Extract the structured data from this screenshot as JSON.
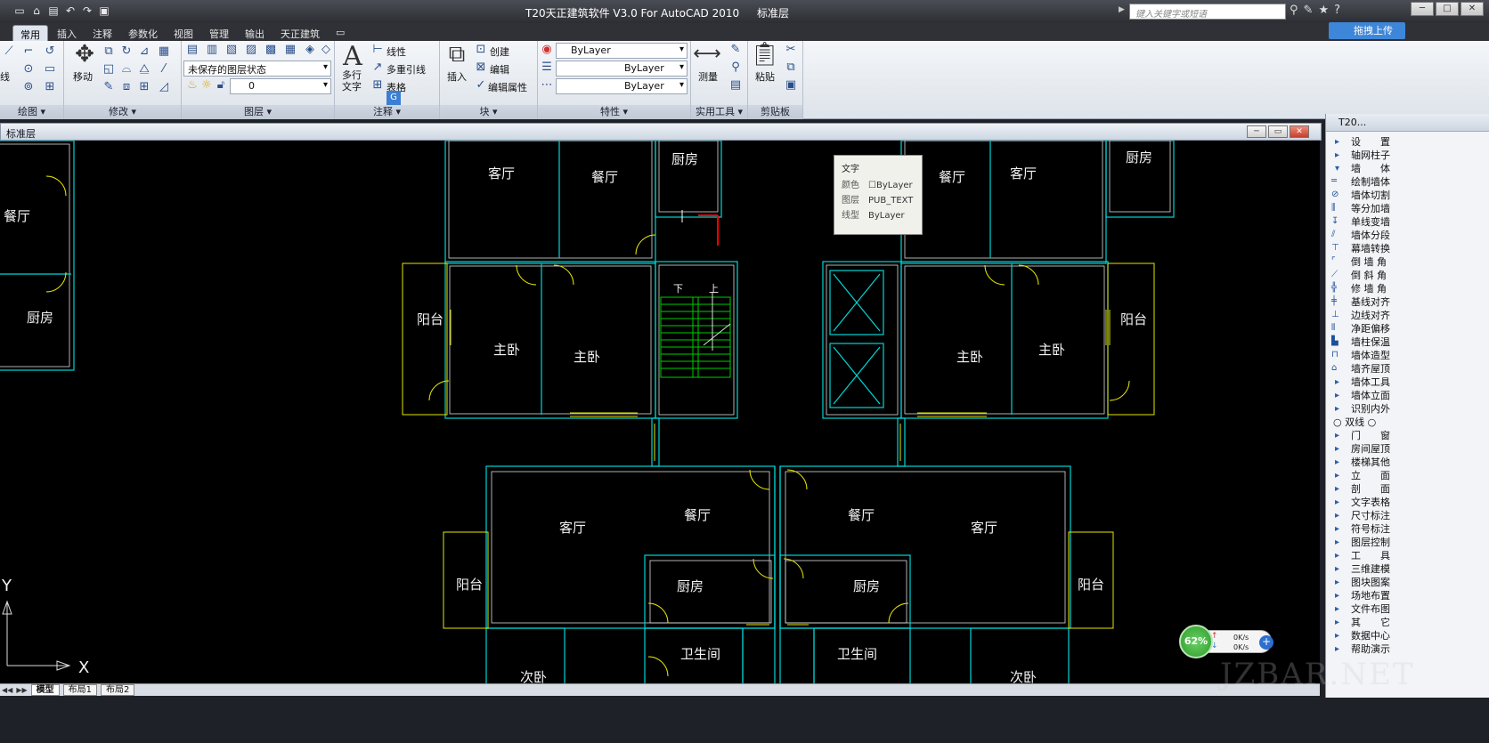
{
  "app": {
    "title": "T20天正建筑软件 V3.0 For AutoCAD 2010",
    "layer_title": "标准层",
    "search_placeholder": "键入关键字或短语",
    "upload_label": "拖拽上传"
  },
  "quick_access": [
    "new-icon",
    "open-icon",
    "save-icon",
    "undo-icon",
    "redo-icon",
    "print-icon"
  ],
  "ribbon_tabs": [
    {
      "label": "常用",
      "active": true
    },
    {
      "label": "插入"
    },
    {
      "label": "注释"
    },
    {
      "label": "参数化"
    },
    {
      "label": "视图"
    },
    {
      "label": "管理"
    },
    {
      "label": "输出"
    },
    {
      "label": "天正建筑"
    }
  ],
  "ribbon": {
    "draw": {
      "title": "绘图",
      "line_label": "线"
    },
    "modify": {
      "title": "修改",
      "move_label": "移动"
    },
    "layers": {
      "title": "图层",
      "state_value": "未保存的图层状态",
      "current_layer": "0"
    },
    "annotation": {
      "title": "注释",
      "mtext_label": "多行文字",
      "linear_label": "线性",
      "leader_label": "多重引线",
      "table_label": "表格"
    },
    "block": {
      "title": "块",
      "insert_label": "插入",
      "create_label": "创建",
      "edit_label": "编辑",
      "edit_attr_label": "编辑属性"
    },
    "properties": {
      "title": "特性",
      "color_value": "ByLayer",
      "linetype_value": "ByLayer",
      "lineweight_value": "ByLayer"
    },
    "utilities": {
      "title": "实用工具",
      "measure_label": "测量"
    },
    "clipboard": {
      "title": "剪贴板",
      "paste_label": "粘贴"
    }
  },
  "document": {
    "title": "标准层",
    "layout_tabs": [
      {
        "label": "模型",
        "active": true
      },
      {
        "label": "布局1"
      },
      {
        "label": "布局2"
      }
    ]
  },
  "tooltip": {
    "title": "文字",
    "rows": [
      {
        "key": "颜色",
        "value": "ByLayer"
      },
      {
        "key": "图层",
        "value": "PUB_TEXT"
      },
      {
        "key": "线型",
        "value": "ByLayer"
      }
    ]
  },
  "drawing": {
    "rooms": [
      {
        "text": "客厅"
      },
      {
        "text": "餐厅"
      },
      {
        "text": "厨房"
      },
      {
        "text": "餐厅"
      },
      {
        "text": "客厅"
      },
      {
        "text": "厨房"
      },
      {
        "text": "餐厅"
      },
      {
        "text": "厨房"
      },
      {
        "text": "阳台"
      },
      {
        "text": "主卧"
      },
      {
        "text": "主卧"
      },
      {
        "text": "主卧"
      },
      {
        "text": "主卧"
      },
      {
        "text": "阳台"
      },
      {
        "text": "下"
      },
      {
        "text": "上"
      },
      {
        "text": "客厅"
      },
      {
        "text": "餐厅"
      },
      {
        "text": "餐厅"
      },
      {
        "text": "客厅"
      },
      {
        "text": "阳台"
      },
      {
        "text": "厨房"
      },
      {
        "text": "厨房"
      },
      {
        "text": "阳台"
      },
      {
        "text": "卫生间"
      },
      {
        "text": "卫生间"
      },
      {
        "text": "次卧"
      },
      {
        "text": "次卧"
      }
    ],
    "ucs_y": "Y",
    "ucs_x": "X"
  },
  "t20_panel": {
    "title": "T20...",
    "items": [
      {
        "label": "设　　置",
        "kind": "cat"
      },
      {
        "label": "轴网柱子",
        "kind": "cat"
      },
      {
        "label": "墙　　体",
        "kind": "cat",
        "open": true
      },
      {
        "label": "绘制墙体",
        "kind": "sub",
        "icon": "wall-draw-icon"
      },
      {
        "label": "墙体切割",
        "kind": "sub",
        "icon": "wall-cut-icon"
      },
      {
        "label": "等分加墙",
        "kind": "sub",
        "icon": "wall-divide-icon"
      },
      {
        "label": "单线变墙",
        "kind": "sub",
        "icon": "line-to-wall-icon"
      },
      {
        "label": "墙体分段",
        "kind": "sub",
        "icon": "wall-segment-icon"
      },
      {
        "label": "幕墙转换",
        "kind": "sub",
        "icon": "curtain-wall-icon"
      },
      {
        "label": "倒 墙 角",
        "kind": "sub",
        "icon": "wall-fillet-icon"
      },
      {
        "label": "倒 斜 角",
        "kind": "sub",
        "icon": "wall-chamfer-icon"
      },
      {
        "label": "修 墙 角",
        "kind": "sub",
        "icon": "wall-fix-icon"
      },
      {
        "label": "基线对齐",
        "kind": "sub",
        "icon": "baseline-align-icon"
      },
      {
        "label": "边线对齐",
        "kind": "sub",
        "icon": "edge-align-icon"
      },
      {
        "label": "净距偏移",
        "kind": "sub",
        "icon": "offset-icon"
      },
      {
        "label": "墙柱保温",
        "kind": "sub",
        "icon": "insulation-icon"
      },
      {
        "label": "墙体造型",
        "kind": "sub",
        "icon": "wall-shape-icon"
      },
      {
        "label": "墙齐屋顶",
        "kind": "sub",
        "icon": "wall-roof-icon"
      },
      {
        "label": "墙体工具",
        "kind": "cat"
      },
      {
        "label": "墙体立面",
        "kind": "cat"
      },
      {
        "label": "识别内外",
        "kind": "cat"
      },
      {
        "label": "○ 双线 ○",
        "kind": "sep"
      },
      {
        "label": "门　　窗",
        "kind": "cat"
      },
      {
        "label": "房间屋顶",
        "kind": "cat"
      },
      {
        "label": "楼梯其他",
        "kind": "cat"
      },
      {
        "label": "立　　面",
        "kind": "cat"
      },
      {
        "label": "剖　　面",
        "kind": "cat"
      },
      {
        "label": "文字表格",
        "kind": "cat"
      },
      {
        "label": "尺寸标注",
        "kind": "cat"
      },
      {
        "label": "符号标注",
        "kind": "cat"
      },
      {
        "label": "图层控制",
        "kind": "cat"
      },
      {
        "label": "工　　具",
        "kind": "cat"
      },
      {
        "label": "三维建模",
        "kind": "cat"
      },
      {
        "label": "图块图案",
        "kind": "cat"
      },
      {
        "label": "场地布置",
        "kind": "cat"
      },
      {
        "label": "文件布图",
        "kind": "cat"
      },
      {
        "label": "其　　它",
        "kind": "cat"
      },
      {
        "label": "数据中心",
        "kind": "cat"
      },
      {
        "label": "帮助演示",
        "kind": "cat"
      }
    ]
  },
  "network": {
    "percent": "62%",
    "up": "0K/s",
    "down": "0K/s"
  },
  "watermark": "JZBAR.NET",
  "colors": {
    "wall": "#00d5d5",
    "wall_inner": "#f2f2f2",
    "balcony": "#e6e600",
    "stair": "#00cc00",
    "highlight": "#ff0000"
  }
}
